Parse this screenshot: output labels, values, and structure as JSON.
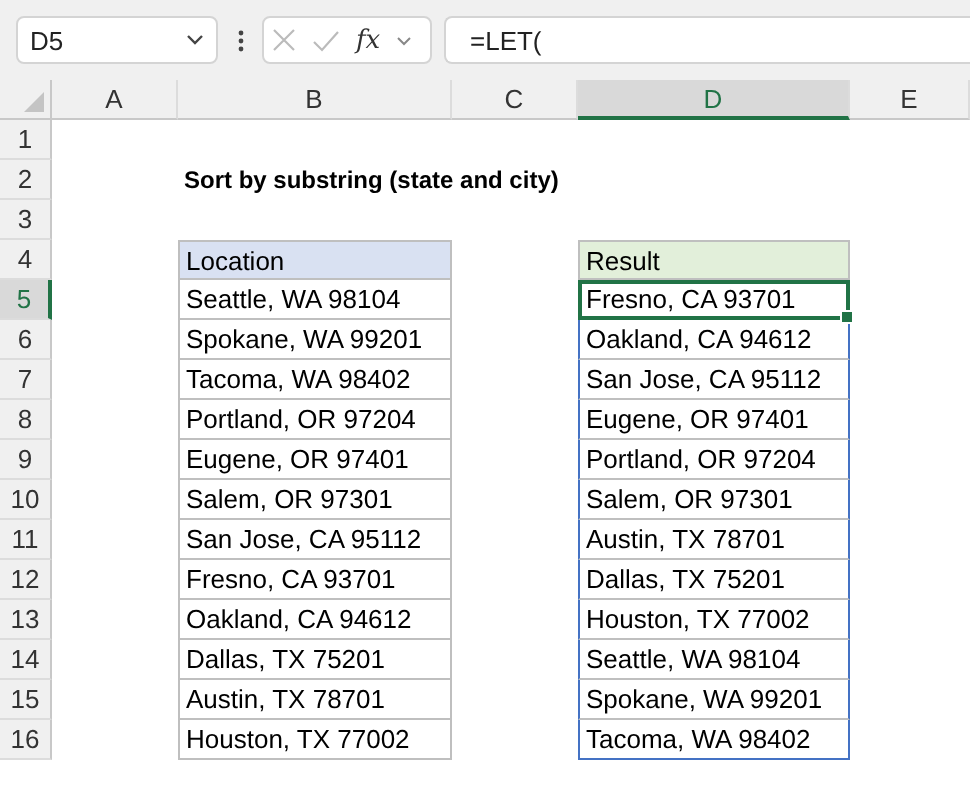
{
  "name_box": {
    "value": "D5"
  },
  "formula_bar": {
    "fx": "fx",
    "formula": "=LET("
  },
  "columns": [
    {
      "label": "A",
      "selected": false
    },
    {
      "label": "B",
      "selected": false
    },
    {
      "label": "C",
      "selected": false
    },
    {
      "label": "D",
      "selected": true
    },
    {
      "label": "E",
      "selected": false
    }
  ],
  "rows": [
    {
      "label": "1",
      "selected": false
    },
    {
      "label": "2",
      "selected": false
    },
    {
      "label": "3",
      "selected": false
    },
    {
      "label": "4",
      "selected": false
    },
    {
      "label": "5",
      "selected": true
    },
    {
      "label": "6",
      "selected": false
    },
    {
      "label": "7",
      "selected": false
    },
    {
      "label": "8",
      "selected": false
    },
    {
      "label": "9",
      "selected": false
    },
    {
      "label": "10",
      "selected": false
    },
    {
      "label": "11",
      "selected": false
    },
    {
      "label": "12",
      "selected": false
    },
    {
      "label": "13",
      "selected": false
    },
    {
      "label": "14",
      "selected": false
    },
    {
      "label": "15",
      "selected": false
    },
    {
      "label": "16",
      "selected": false
    }
  ],
  "title": "Sort by substring (state and city)",
  "tables": [
    {
      "kind": "source",
      "header": "Location",
      "items": [
        {
          "text": "Seattle, WA 98104",
          "selected": false
        },
        {
          "text": "Spokane, WA 99201",
          "selected": false
        },
        {
          "text": "Tacoma, WA 98402",
          "selected": false
        },
        {
          "text": "Portland, OR 97204",
          "selected": false
        },
        {
          "text": "Eugene, OR 97401",
          "selected": false
        },
        {
          "text": "Salem, OR 97301",
          "selected": false
        },
        {
          "text": "San Jose, CA 95112",
          "selected": false
        },
        {
          "text": "Fresno, CA 93701",
          "selected": false
        },
        {
          "text": "Oakland, CA 94612",
          "selected": false
        },
        {
          "text": "Dallas, TX 75201",
          "selected": false
        },
        {
          "text": "Austin, TX 78701",
          "selected": false
        },
        {
          "text": "Houston, TX 77002",
          "selected": false
        }
      ]
    },
    {
      "kind": "result",
      "header": "Result",
      "items": [
        {
          "text": "Fresno, CA 93701",
          "selected": true
        },
        {
          "text": "Oakland, CA 94612",
          "selected": false
        },
        {
          "text": "San Jose, CA 95112",
          "selected": false
        },
        {
          "text": "Eugene, OR 97401",
          "selected": false
        },
        {
          "text": "Portland, OR 97204",
          "selected": false
        },
        {
          "text": "Salem, OR 97301",
          "selected": false
        },
        {
          "text": "Austin, TX 78701",
          "selected": false
        },
        {
          "text": "Dallas, TX 75201",
          "selected": false
        },
        {
          "text": "Houston, TX 77002",
          "selected": false
        },
        {
          "text": "Seattle, WA 98104",
          "selected": false
        },
        {
          "text": "Spokane, WA 99201",
          "selected": false
        },
        {
          "text": "Tacoma, WA 98402",
          "selected": false
        }
      ]
    }
  ]
}
